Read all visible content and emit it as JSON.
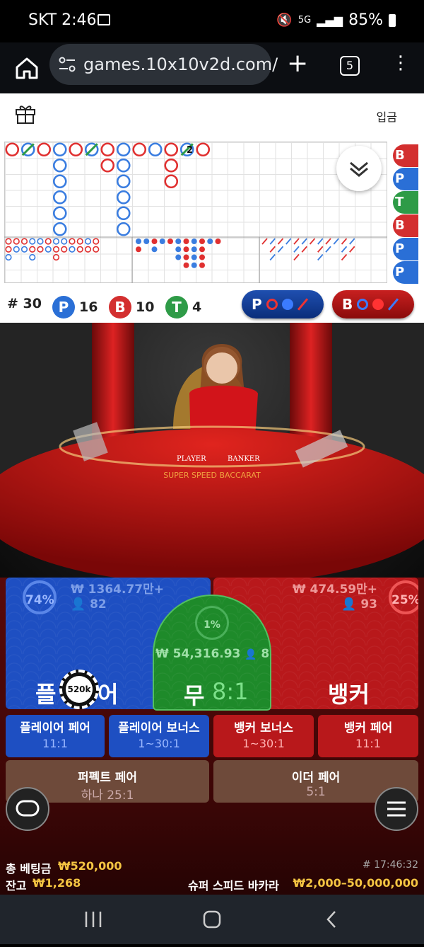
{
  "status_bar": {
    "carrier_time": "SKT 2:46",
    "network": "5G",
    "battery": "85%"
  },
  "browser": {
    "url": "games.10x10v2d.com/",
    "tab_count": "5"
  },
  "app_header": {
    "deposit_label": "입금"
  },
  "roadmap": {
    "big_road": [
      {
        "col": 0,
        "row": 0,
        "type": "B"
      },
      {
        "col": 1,
        "row": 0,
        "type": "T"
      },
      {
        "col": 2,
        "row": 0,
        "type": "B"
      },
      {
        "col": 3,
        "row": 0,
        "type": "P"
      },
      {
        "col": 3,
        "row": 1,
        "type": "P"
      },
      {
        "col": 3,
        "row": 2,
        "type": "P"
      },
      {
        "col": 3,
        "row": 3,
        "type": "P"
      },
      {
        "col": 3,
        "row": 4,
        "type": "P"
      },
      {
        "col": 3,
        "row": 5,
        "type": "P"
      },
      {
        "col": 4,
        "row": 0,
        "type": "B"
      },
      {
        "col": 5,
        "row": 0,
        "type": "T"
      },
      {
        "col": 6,
        "row": 0,
        "type": "B"
      },
      {
        "col": 6,
        "row": 1,
        "type": "B"
      },
      {
        "col": 7,
        "row": 0,
        "type": "P"
      },
      {
        "col": 7,
        "row": 1,
        "type": "P"
      },
      {
        "col": 7,
        "row": 2,
        "type": "P"
      },
      {
        "col": 7,
        "row": 3,
        "type": "P"
      },
      {
        "col": 7,
        "row": 4,
        "type": "P"
      },
      {
        "col": 7,
        "row": 5,
        "type": "P"
      },
      {
        "col": 8,
        "row": 0,
        "type": "B"
      },
      {
        "col": 9,
        "row": 0,
        "type": "P"
      },
      {
        "col": 10,
        "row": 0,
        "type": "B"
      },
      {
        "col": 10,
        "row": 1,
        "type": "B"
      },
      {
        "col": 10,
        "row": 2,
        "type": "B"
      },
      {
        "col": 11,
        "row": 0,
        "type": "T"
      },
      {
        "col": 12,
        "row": 0,
        "type": "B"
      }
    ],
    "tie_count_label": "2",
    "predictions": [
      "B",
      "P",
      "T",
      "B",
      "P",
      "P"
    ],
    "prediction_colors": {
      "B": "#d32f2f",
      "P": "#2a6fd6",
      "T": "#2e9b47"
    }
  },
  "stats": {
    "total_label": "# 30",
    "player_letter": "P",
    "player_count": "16",
    "banker_letter": "B",
    "banker_count": "10",
    "tie_letter": "T",
    "tie_count": "4"
  },
  "predict_buttons": {
    "player_letter": "P",
    "banker_letter": "B"
  },
  "table": {
    "player_text": "PLAYER",
    "banker_text": "BANKER",
    "game_logo": "SUPER SPEED BACCARAT"
  },
  "betting": {
    "player": {
      "percent": "74%",
      "amount": "₩ 1364.77만+",
      "players": "82",
      "label_left": "플",
      "label_right": "어"
    },
    "tie": {
      "percent": "1%",
      "amount": "₩ 54,316.93",
      "players": "8",
      "label": "무",
      "odds": "8:1"
    },
    "banker": {
      "percent": "25%",
      "amount": "₩ 474.59만+",
      "players": "93",
      "label": "뱅커"
    },
    "chip": "520k",
    "side_bets": [
      {
        "label": "플레이어 페어",
        "odds": "11:1"
      },
      {
        "label": "플레이어 보너스",
        "odds": "1~30:1"
      },
      {
        "label": "뱅커 보너스",
        "odds": "1~30:1"
      },
      {
        "label": "뱅커 페어",
        "odds": "11:1"
      }
    ],
    "perfect_pair": {
      "label": "퍼펙트 페어",
      "odds": "하나 25:1"
    },
    "either_pair": {
      "label": "이더 페어",
      "odds": "5:1"
    }
  },
  "footer": {
    "total_bet_label": "총 베팅금",
    "total_bet_value": "₩520,000",
    "balance_label": "잔고",
    "balance_value": "₩1,268",
    "round_id": "# 17:46:32",
    "game_name": "슈퍼 스피드 바카라",
    "limits": "₩2,000–50,000,000"
  }
}
